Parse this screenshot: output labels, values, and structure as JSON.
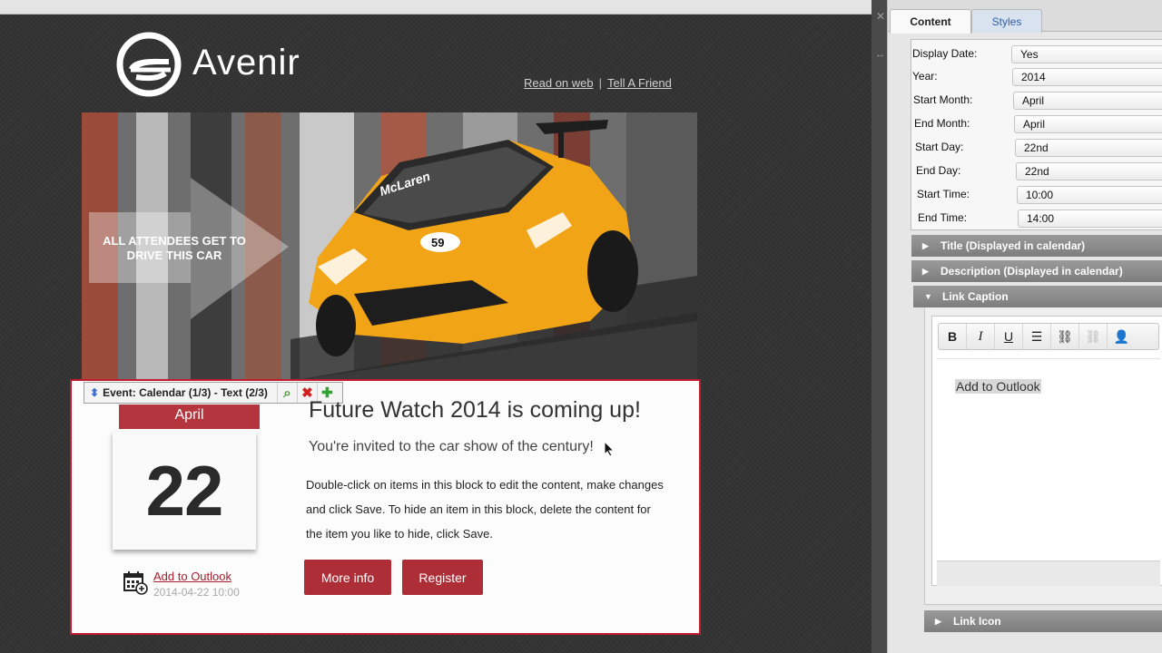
{
  "email": {
    "brand": "Avenir",
    "links": {
      "read_on_web": "Read on web",
      "separator": "|",
      "tell_friend": "Tell A Friend"
    },
    "hero_caption": "ALL ATTENDEES GET TO DRIVE THIS CAR",
    "hero_car_text": {
      "brand": "McLaren",
      "number": "59"
    },
    "block_toolbar": {
      "label": "Event: Calendar (1/3) - Text (2/3)"
    },
    "calendar": {
      "month": "April",
      "day": "22"
    },
    "outlook": {
      "link": "Add to Outlook",
      "datetime": "2014-04-22 10:00"
    },
    "event": {
      "title": "Future Watch 2014 is coming up!",
      "subtitle": "You're invited to the car show of the century!",
      "body": "Double-click on items in this block to edit the content, make changes and click Save. To hide an item in this block, delete the content for the item you like to hide, click Save.",
      "more_info": "More info",
      "register": "Register"
    }
  },
  "panel": {
    "tabs": {
      "content": "Content",
      "styles": "Styles"
    },
    "fields": [
      {
        "label": "Display Date:",
        "value": "Yes"
      },
      {
        "label": "Year:",
        "value": "2014"
      },
      {
        "label": "Start Month:",
        "value": "April"
      },
      {
        "label": "End  Month:",
        "value": "April"
      },
      {
        "label": "Start Day:",
        "value": "22nd"
      },
      {
        "label": "End  Day:",
        "value": "22nd"
      },
      {
        "label": "Start Time:",
        "value": "10:00"
      },
      {
        "label": "End  Time:",
        "value": "14:00"
      }
    ],
    "sections": {
      "title": "Title (Displayed in calendar)",
      "description": "Description (Displayed in calendar)",
      "link_caption": "Link Caption",
      "link_icon": "Link Icon"
    },
    "editor": {
      "content": "Add to Outlook"
    }
  },
  "colors": {
    "accent_red": "#ad2e36",
    "block_border": "#c21b2f",
    "car_orange": "#f2a417"
  }
}
